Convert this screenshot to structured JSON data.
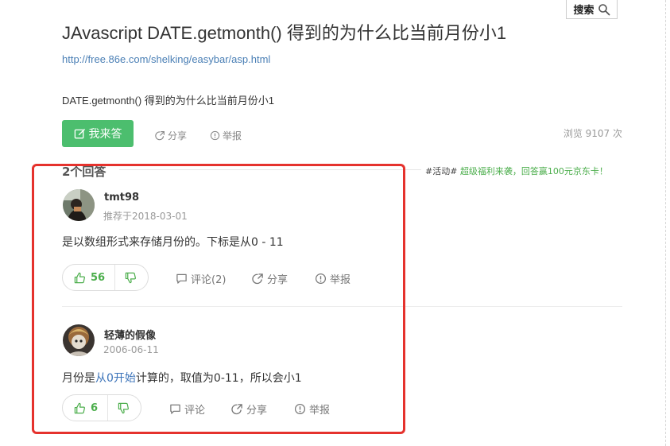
{
  "header": {
    "search_label": "搜索"
  },
  "question": {
    "title": "JAvascript DATE.getmonth() 得到的为什么比当前月份小1",
    "source_url": "http://free.86e.com/shelking/easybar/asp.html",
    "body": "DATE.getmonth() 得到的为什么比当前月份小1",
    "answer_button_label": "我来答",
    "share_label": "分享",
    "report_label": "举报",
    "view_count": "浏览 9107 次"
  },
  "answers_section": {
    "heading": "2个回答",
    "promo_tag": "#活动#",
    "promo_text": "超级福利来袭，回答赢100元京东卡！"
  },
  "answers": [
    {
      "author": "tmt98",
      "date": "推荐于2018-03-01",
      "text": "是以数组形式来存储月份的。下标是从0 - 11",
      "upvotes": "56",
      "comment_label": "评论(2)",
      "share_label": "分享",
      "report_label": "举报"
    },
    {
      "author": "轻薄的假像",
      "date": "2006-06-11",
      "text_prefix": "月份是",
      "text_link": "从0开始",
      "text_suffix": "计算的，取值为0-11，所以会小1",
      "upvotes": "6",
      "comment_label": "评论",
      "share_label": "分享",
      "report_label": "举报"
    }
  ],
  "colors": {
    "accent_green": "#4cbe6e",
    "highlight_red": "#e5322d",
    "link_blue": "#4a7fb5"
  }
}
